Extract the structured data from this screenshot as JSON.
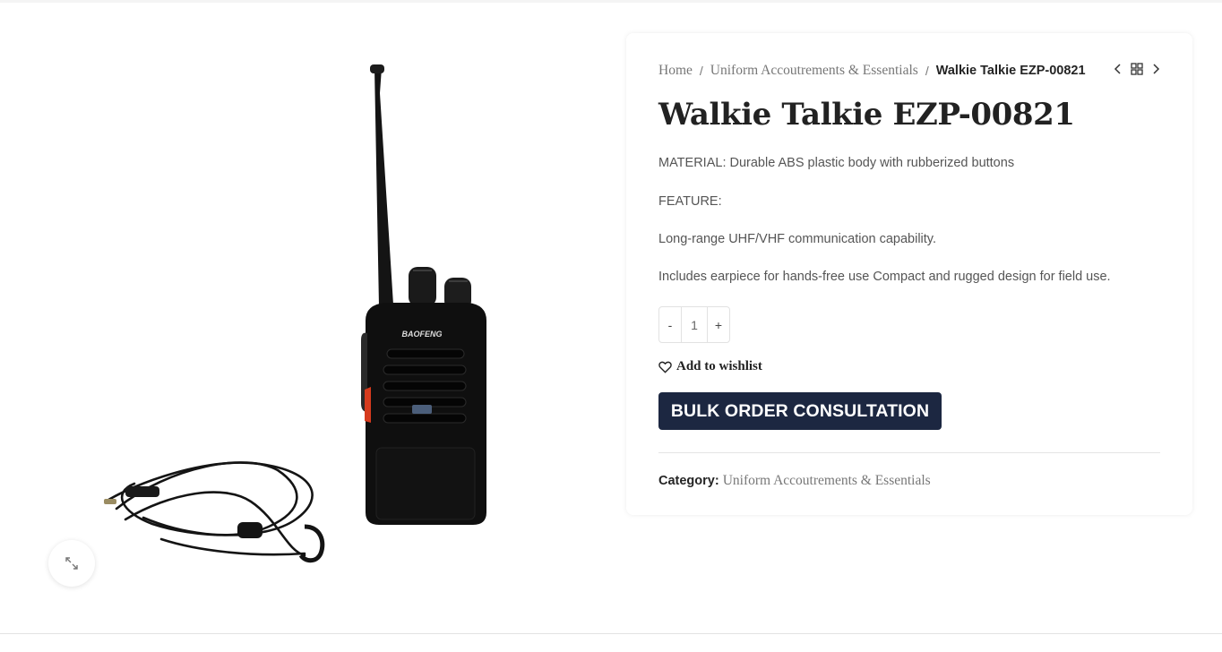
{
  "breadcrumb": {
    "home": "Home",
    "separator": "/",
    "category": "Uniform Accoutrements & Essentials",
    "current": "Walkie Talkie EZP-00821"
  },
  "product": {
    "title": "Walkie Talkie EZP-00821",
    "description": [
      "MATERIAL: Durable ABS plastic body with rubberized buttons",
      "FEATURE:",
      "Long-range  UHF/VHF communication capability.",
      "Includes earpiece for hands-free use Compact and rugged design for field use."
    ],
    "image_alt": "BAOFENG",
    "image_icons": [
      "walkie-talkie-image",
      "earpiece-cable"
    ]
  },
  "quantity": {
    "minus": "-",
    "value": "1",
    "plus": "+"
  },
  "wishlist": {
    "label": "Add to wishlist",
    "icon": "heart-icon"
  },
  "actions": {
    "bulk_order": "BULK ORDER CONSULTATION"
  },
  "category": {
    "label": "Category:",
    "value": "Uniform Accoutrements & Essentials"
  },
  "nav_icons": [
    "chevron-left-icon",
    "grid-icon",
    "chevron-right-icon"
  ],
  "zoom_icon": "expand-icon",
  "colors": {
    "button_bg": "#1c2741",
    "button_text": "#ffffff",
    "muted_text": "#777777",
    "title_text": "#222222"
  }
}
